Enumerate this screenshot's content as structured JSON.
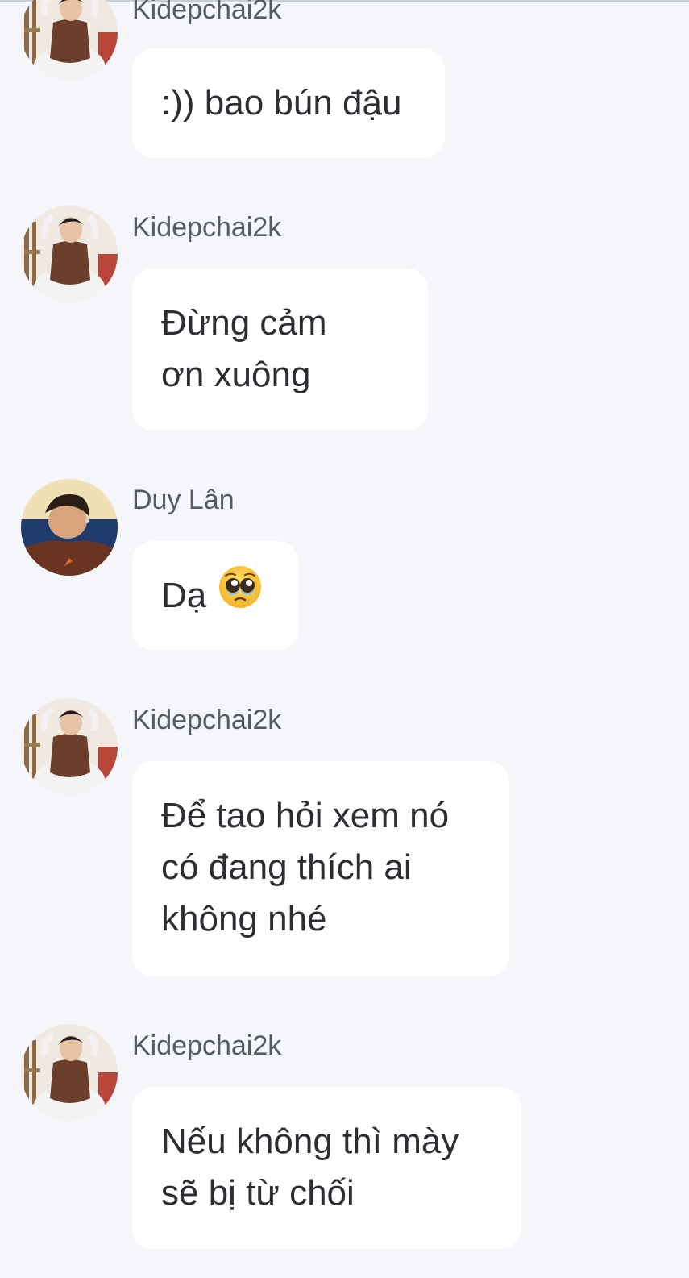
{
  "messages": [
    {
      "sender": "Kidepchai2k",
      "avatar": "kidepchai-avatar",
      "lines": [
        ":)) bao bún đậu"
      ]
    },
    {
      "sender": "Kidepchai2k",
      "avatar": "kidepchai-avatar",
      "lines": [
        "Đừng cảm",
        "ơn xuông"
      ]
    },
    {
      "sender": "Duy Lân",
      "avatar": "duylan-avatar",
      "lines": [
        "Dạ"
      ],
      "emoji": "pleading-face-icon"
    },
    {
      "sender": "Kidepchai2k",
      "avatar": "kidepchai-avatar",
      "lines": [
        "Để tao hỏi xem nó",
        "có đang thích ai",
        "không nhé"
      ]
    },
    {
      "sender": "Kidepchai2k",
      "avatar": "kidepchai-avatar",
      "lines": [
        "Nếu không thì mày",
        "sẽ bị từ chối"
      ]
    }
  ],
  "colors": {
    "background": "#f4f6f9",
    "bubble": "#ffffff",
    "sender_text": "#555a63",
    "message_text": "#2b2e33"
  }
}
